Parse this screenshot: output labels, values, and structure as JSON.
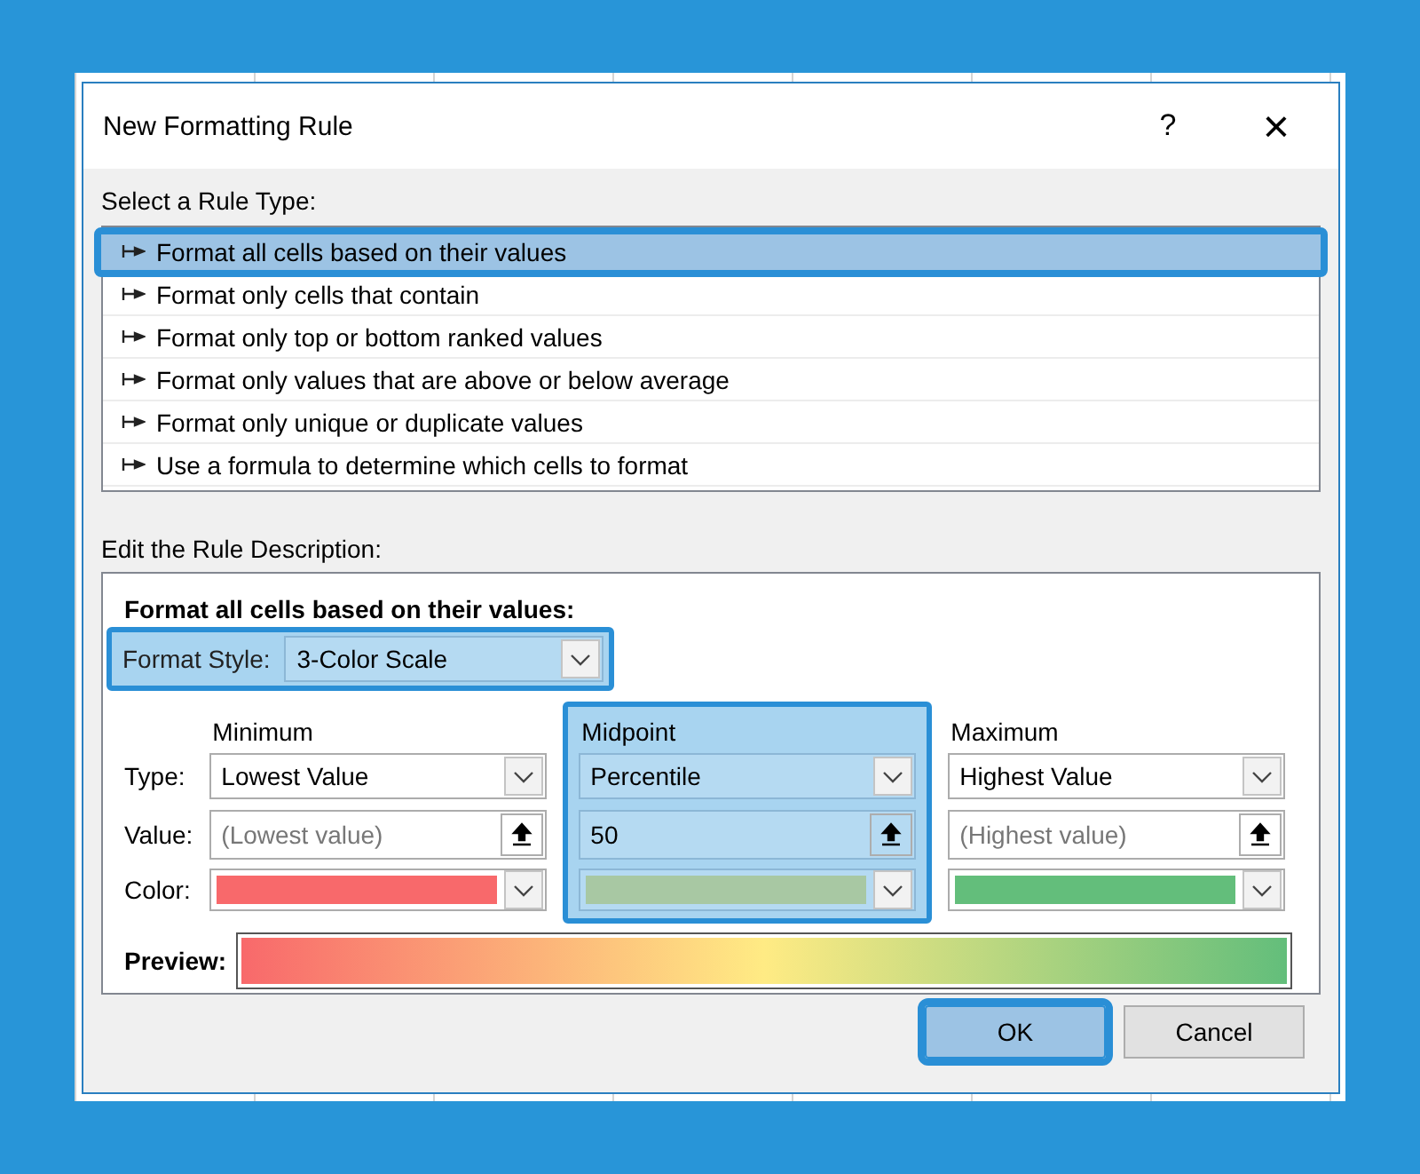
{
  "window": {
    "title": "New Formatting Rule",
    "help": "?",
    "close": "×"
  },
  "rule_type": {
    "label": "Select a Rule Type:",
    "items": [
      {
        "label": "Format all cells based on their values",
        "selected": true
      },
      {
        "label": "Format only cells that contain",
        "selected": false
      },
      {
        "label": "Format only top or bottom ranked values",
        "selected": false
      },
      {
        "label": "Format only values that are above or below average",
        "selected": false
      },
      {
        "label": "Format only unique or duplicate values",
        "selected": false
      },
      {
        "label": "Use a formula to determine which cells to format",
        "selected": false
      }
    ]
  },
  "rule_description": {
    "label": "Edit the Rule Description:",
    "heading": "Format all cells based on their values:",
    "format_style": {
      "label": "Format Style:",
      "value": "3-Color Scale",
      "highlighted": true
    },
    "row_labels": [
      {
        "label": "Type:"
      },
      {
        "label": "Value:"
      },
      {
        "label": "Color:"
      }
    ],
    "columns": [
      {
        "heading": "Minimum",
        "highlighted": false,
        "type": "Lowest Value",
        "value_field": {
          "placeholder": "(Lowest value)"
        },
        "color": "#f8696b"
      },
      {
        "heading": "Midpoint",
        "highlighted": true,
        "type": "Percentile",
        "value_field": {
          "value": "50"
        },
        "color": "#a8c8a3"
      },
      {
        "heading": "Maximum",
        "highlighted": false,
        "type": "Highest Value",
        "value_field": {
          "placeholder": "(Highest value)"
        },
        "color": "#63be7b"
      }
    ],
    "preview": {
      "label": "Preview:"
    }
  },
  "buttons": [
    {
      "label": "OK",
      "highlighted": true
    },
    {
      "label": "Cancel",
      "highlighted": false
    }
  ]
}
